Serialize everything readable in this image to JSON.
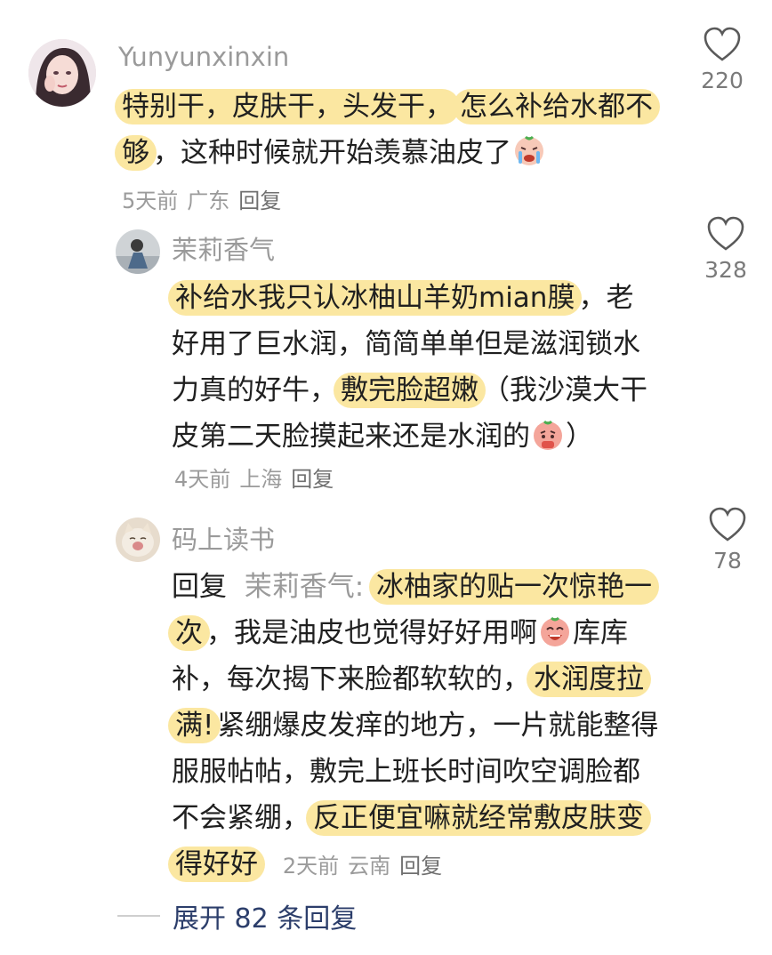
{
  "comments": [
    {
      "username": "Yunyunxinxin",
      "text_parts": [
        "特别干，皮肤干，头发干，",
        "怎么补给水都不够",
        "，这种时候就开始羡慕油皮了"
      ],
      "emoji": "crying-emoji",
      "meta": {
        "time": "5天前",
        "location": "广东",
        "reply": "回复"
      },
      "likes": "220"
    },
    {
      "username": "茉莉香气",
      "text_parts": [
        "补给水我只认冰柚山羊奶mian膜",
        "，老好用了巨水润，简简单单但是滋润锁水力真的好牛，",
        "敷完脸超嫩",
        "（我沙漠大干皮第二天脸摸起来还是水润的",
        "）"
      ],
      "emoji": "pleading-emoji",
      "meta": {
        "time": "4天前",
        "location": "上海",
        "reply": "回复"
      },
      "likes": "328"
    },
    {
      "username": "码上读书",
      "reply_prefix": "回复",
      "reply_target": "茉莉香气:",
      "text_parts": [
        "冰柚家的贴一次惊艳一次",
        "，我是油皮也觉得好好用啊",
        "库库补，每次揭下来脸都软软的，",
        "水润度拉满!",
        "紧绷爆皮发痒的地方，一片就能整得服服帖帖，敷完上班长时间吹空调脸都不会紧绷，",
        "反正便宜嘛就经常敷皮肤变得好好"
      ],
      "emoji": "laughing-emoji",
      "meta": {
        "time": "2天前",
        "location": "云南",
        "reply": "回复"
      },
      "likes": "78"
    }
  ],
  "expand_label": "展开 82 条回复",
  "colors": {
    "highlight": "#fbe7a1",
    "username": "#9a9a9a",
    "expand": "#2c3e6b"
  }
}
